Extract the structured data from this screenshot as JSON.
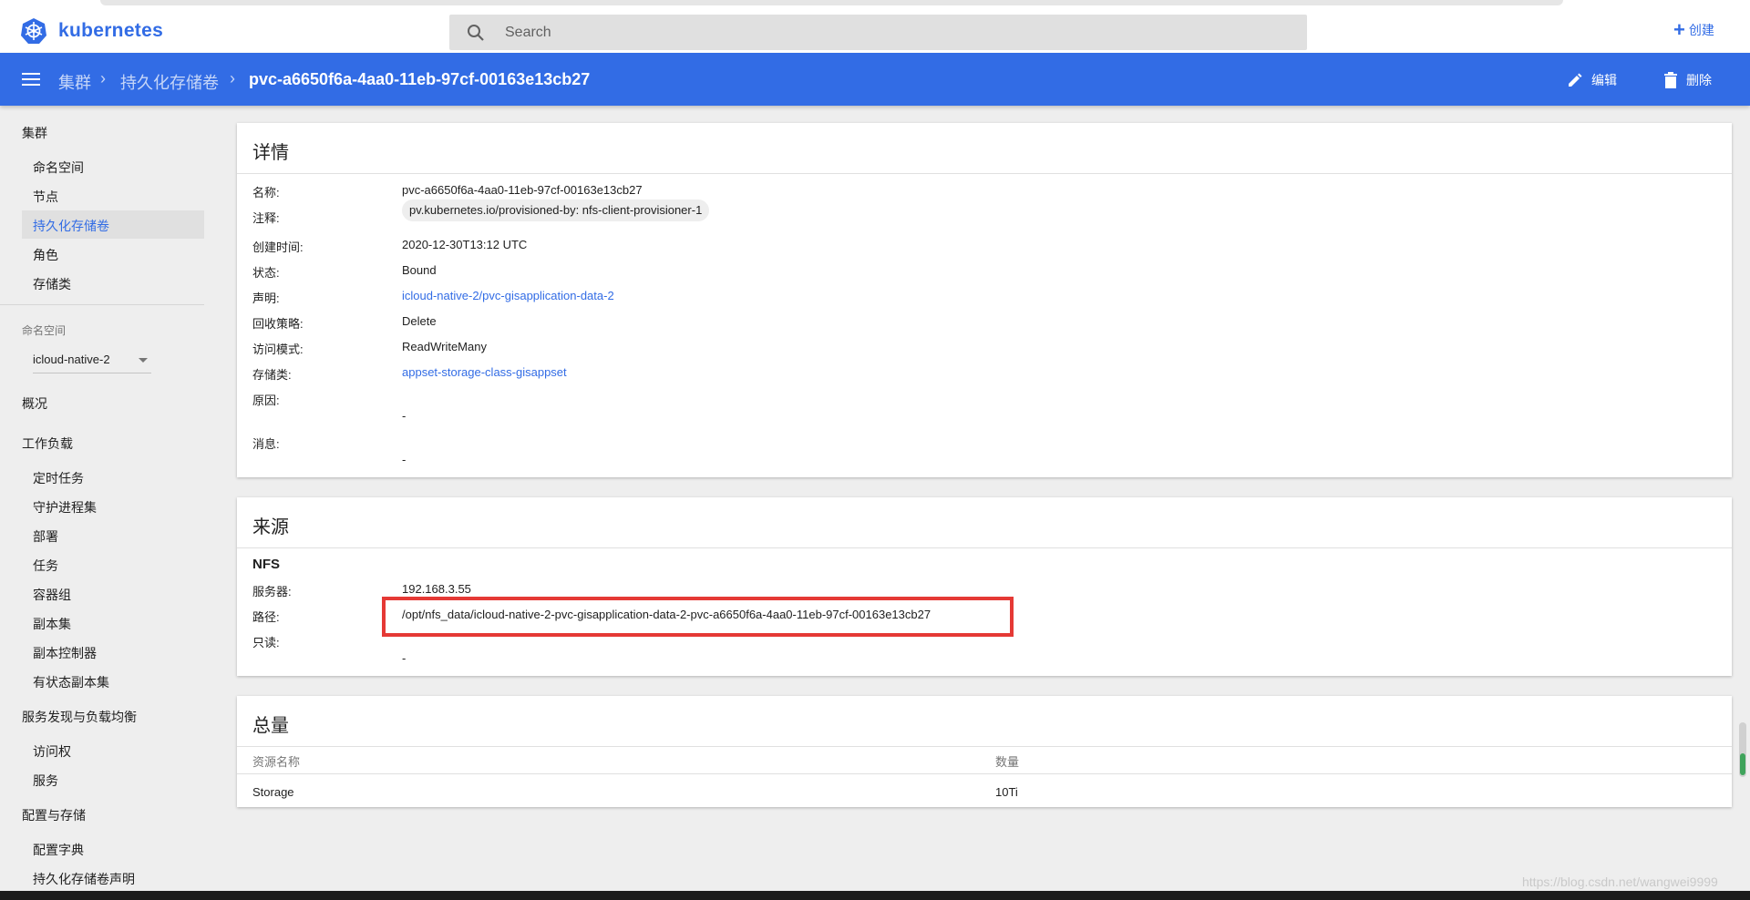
{
  "header": {
    "brand": "kubernetes",
    "search_placeholder": "Search",
    "create_label": "创建"
  },
  "appbar": {
    "breadcrumbs": [
      "集群",
      "持久化存储卷"
    ],
    "current": "pvc-a6650f6a-4aa0-11eb-97cf-00163e13cb27",
    "edit_label": "编辑",
    "delete_label": "删除"
  },
  "sidebar": {
    "cluster_section": "集群",
    "cluster_items": [
      "命名空间",
      "节点",
      "持久化存储卷",
      "角色",
      "存储类"
    ],
    "active_item": "持久化存储卷",
    "namespace_label": "命名空间",
    "namespace_value": "icloud-native-2",
    "overview": "概况",
    "workloads_section": "工作负载",
    "workload_items": [
      "定时任务",
      "守护进程集",
      "部署",
      "任务",
      "容器组",
      "副本集",
      "副本控制器",
      "有状态副本集"
    ],
    "discovery_section": "服务发现与负载均衡",
    "discovery_items": [
      "访问权",
      "服务"
    ],
    "config_section": "配置与存储",
    "config_items": [
      "配置字典",
      "持久化存储卷声明"
    ]
  },
  "details": {
    "title": "详情",
    "rows": {
      "name_label": "名称:",
      "name": "pvc-a6650f6a-4aa0-11eb-97cf-00163e13cb27",
      "annotation_label": "注释:",
      "annotation": "pv.kubernetes.io/provisioned-by:  nfs-client-provisioner-1",
      "created_label": "创建时间:",
      "created": "2020-12-30T13:12 UTC",
      "status_label": "状态:",
      "status": "Bound",
      "claim_label": "声明:",
      "claim": "icloud-native-2/pvc-gisapplication-data-2",
      "reclaim_label": "回收策略:",
      "reclaim": "Delete",
      "access_label": "访问模式:",
      "access": "ReadWriteMany",
      "storageclass_label": "存储类:",
      "storageclass": "appset-storage-class-gisappset",
      "reason_label": "原因:",
      "reason": "-",
      "message_label": "消息:",
      "message": "-"
    }
  },
  "source": {
    "title": "来源",
    "type": "NFS",
    "server_label": "服务器:",
    "server": "192.168.3.55",
    "path_label": "路径:",
    "path": "/opt/nfs_data/icloud-native-2-pvc-gisapplication-data-2-pvc-a6650f6a-4aa0-11eb-97cf-00163e13cb27",
    "readonly_label": "只读:",
    "readonly": "-"
  },
  "capacity": {
    "title": "总量",
    "col_name": "资源名称",
    "col_qty": "数量",
    "row_name": "Storage",
    "row_qty": "10Ti"
  },
  "watermark": "https://blog.csdn.net/wangwei9999",
  "colors": {
    "accent": "#326ce5",
    "highlight": "#e53935"
  }
}
